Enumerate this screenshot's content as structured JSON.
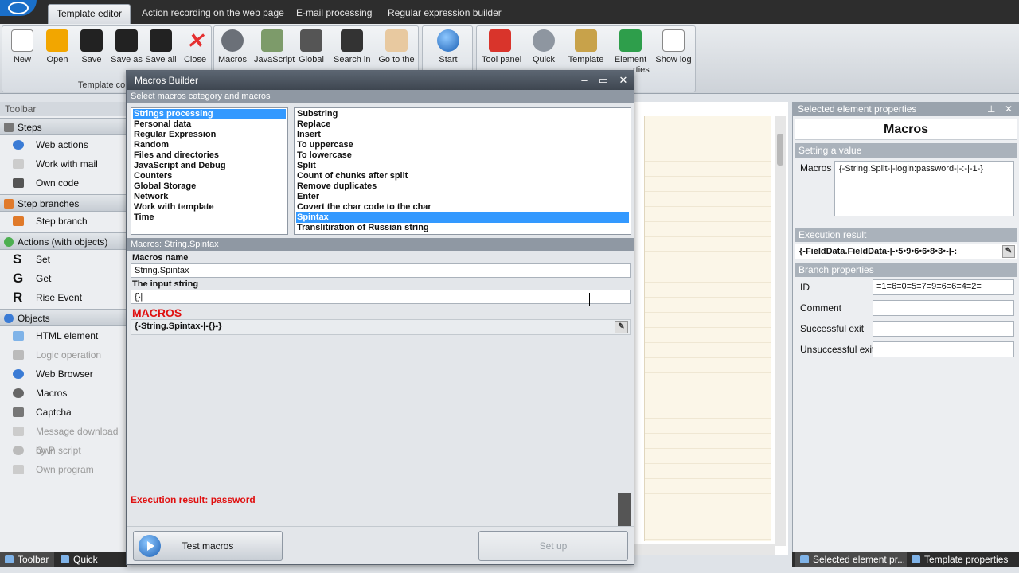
{
  "tabs": [
    "Template editor",
    "Action recording on the web page",
    "E-mail processing",
    "Regular expression builder"
  ],
  "ribbon": {
    "file_buttons": [
      "New",
      "Open",
      "Save",
      "Save as",
      "Save all",
      "Close"
    ],
    "group1_label": "Template contr",
    "tool_buttons": [
      "Macros",
      "JavaScript",
      "Global",
      "Search in",
      "Go to the"
    ],
    "start_button": "Start",
    "right_buttons": [
      "Tool panel",
      "Quick",
      "Template",
      "Element",
      "Show log"
    ],
    "element_sublabel": "rties"
  },
  "toolbar": {
    "title": "Toolbar",
    "sections": {
      "steps": "Steps",
      "step_branches": "Step branches",
      "actions": "Actions (with objects)",
      "objects": "Objects"
    },
    "steps_items": [
      "Web actions",
      "Work with mail",
      "Own code"
    ],
    "branch_items": [
      "Step branch"
    ],
    "action_items": [
      {
        "letter": "S",
        "label": "Set"
      },
      {
        "letter": "G",
        "label": "Get"
      },
      {
        "letter": "R",
        "label": "Rise Event"
      }
    ],
    "object_items": [
      "HTML element",
      "Logic operation",
      "Web Browser",
      "Macros",
      "Captcha",
      "Message download by P",
      "Own script",
      "Own program"
    ],
    "bottom_tabs": [
      "Toolbar",
      "Quick macros"
    ]
  },
  "modal": {
    "title": "Macros Builder",
    "select_caption": "Select macros category and macros",
    "categories": [
      "Strings processing",
      "Personal data",
      "Regular Expression",
      "Random",
      "Files and directories",
      "JavaScript and Debug",
      "Counters",
      "Global Storage",
      "Network",
      "Work with template",
      "Time"
    ],
    "macros": [
      "Substring",
      "Replace",
      "Insert",
      "To uppercase",
      "To lowercase",
      "Split",
      "Count of chunks after split",
      "Remove duplicates",
      "Enter",
      "Covert the char code to the char",
      "Spintax",
      "Translitiration of Russian string"
    ],
    "macro_caption": "Macros: String.Spintax",
    "macros_name_label": "Macros name",
    "macros_name_value": "String.Spintax",
    "input_label": "The input string",
    "input_value": "{}|",
    "macros_heading": "MACROS",
    "macro_output": "{-String.Spintax-|-{}-}",
    "execution_result": "Execution result: password",
    "test_button": "Test macros",
    "setup_button": "Set up"
  },
  "properties": {
    "title": "Selected element properties",
    "heading": "Macros",
    "setting_value": "Setting a value",
    "macros_label": "Macros",
    "macros_value": "{-String.Split-|-login:password-|-:-|-1-}",
    "execution_title": "Execution result",
    "execution_value": "{-FieldData.FieldData-|-•5•9•6•6•8•3•-|-:",
    "branch_title": "Branch properties",
    "id_label": "ID",
    "id_value": "≡1≡6≡0≡5≡7≡9≡6≡6≡4≡2≡",
    "comment_label": "Comment",
    "success_label": "Successful exit",
    "unsuccess_label": "Unsuccessful exit",
    "bottom_tabs": [
      "Selected element pr...",
      "Template properties"
    ]
  },
  "colors": {
    "accent_red": "#e01010",
    "selection": "#3399ff"
  }
}
